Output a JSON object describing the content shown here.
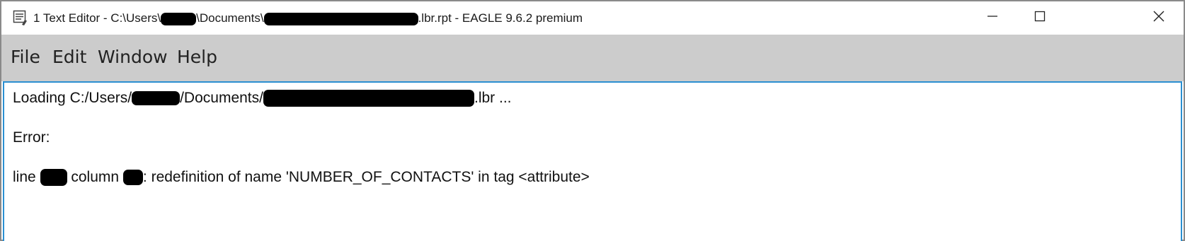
{
  "window": {
    "title_prefix": "1 Text Editor - C:\\Users\\",
    "title_mid": "\\Documents\\",
    "title_suffix": ".lbr.rpt - EAGLE 9.6.2 premium",
    "icons": {
      "app": "text-editor-icon",
      "minimize": "minimize-icon",
      "maximize": "maximize-icon",
      "close": "close-icon"
    }
  },
  "menu": {
    "file": "File",
    "edit": "Edit",
    "window": "Window",
    "help": "Help"
  },
  "editor": {
    "line1_prefix": "Loading C:/Users/",
    "line1_mid": "/Documents/",
    "line1_suffix": ".lbr ...",
    "line2": "Error:",
    "line3_a": "line ",
    "line3_b": " column ",
    "line3_c": ": redefinition of name 'NUMBER_OF_CONTACTS' in tag <attribute>"
  }
}
